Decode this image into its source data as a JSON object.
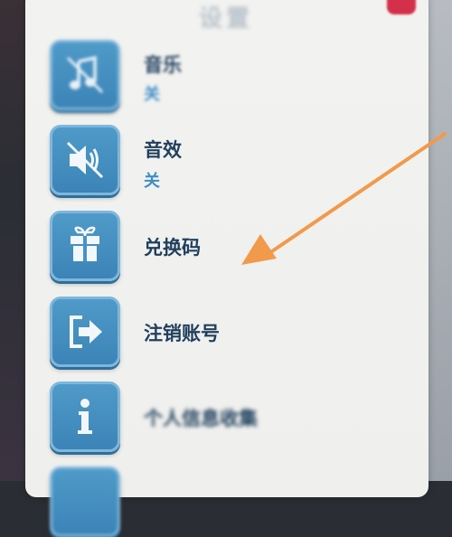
{
  "header": {
    "title": "设置"
  },
  "items": [
    {
      "label": "音乐",
      "state": "关",
      "icon": "music-off-icon"
    },
    {
      "label": "音效",
      "state": "关",
      "icon": "sound-muted-icon"
    },
    {
      "label": "兑换码",
      "icon": "gift-icon"
    },
    {
      "label": "注销账号",
      "icon": "logout-arrow-icon"
    },
    {
      "label": "个人信息收集",
      "icon": "info-icon"
    }
  ],
  "colors": {
    "button_blue": "#3c84b7",
    "label_dark": "#1f3f5c",
    "state_blue": "#3c8ec4",
    "annotation_arrow": "#f19a4c"
  }
}
